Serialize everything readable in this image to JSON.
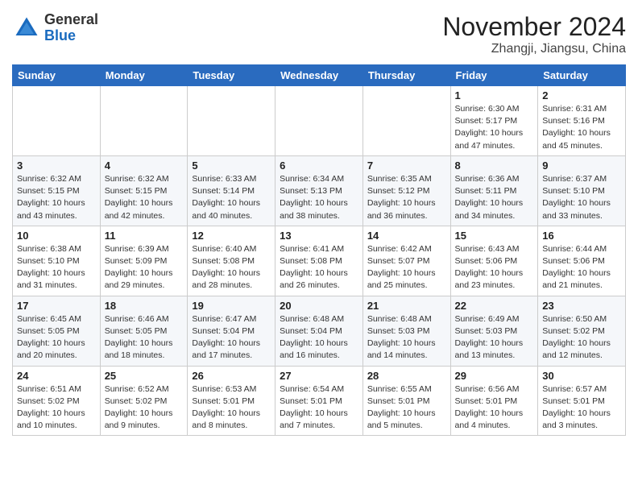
{
  "header": {
    "logo_general": "General",
    "logo_blue": "Blue",
    "month": "November 2024",
    "location": "Zhangji, Jiangsu, China"
  },
  "weekdays": [
    "Sunday",
    "Monday",
    "Tuesday",
    "Wednesday",
    "Thursday",
    "Friday",
    "Saturday"
  ],
  "weeks": [
    [
      {
        "day": "",
        "info": ""
      },
      {
        "day": "",
        "info": ""
      },
      {
        "day": "",
        "info": ""
      },
      {
        "day": "",
        "info": ""
      },
      {
        "day": "",
        "info": ""
      },
      {
        "day": "1",
        "info": "Sunrise: 6:30 AM\nSunset: 5:17 PM\nDaylight: 10 hours\nand 47 minutes."
      },
      {
        "day": "2",
        "info": "Sunrise: 6:31 AM\nSunset: 5:16 PM\nDaylight: 10 hours\nand 45 minutes."
      }
    ],
    [
      {
        "day": "3",
        "info": "Sunrise: 6:32 AM\nSunset: 5:15 PM\nDaylight: 10 hours\nand 43 minutes."
      },
      {
        "day": "4",
        "info": "Sunrise: 6:32 AM\nSunset: 5:15 PM\nDaylight: 10 hours\nand 42 minutes."
      },
      {
        "day": "5",
        "info": "Sunrise: 6:33 AM\nSunset: 5:14 PM\nDaylight: 10 hours\nand 40 minutes."
      },
      {
        "day": "6",
        "info": "Sunrise: 6:34 AM\nSunset: 5:13 PM\nDaylight: 10 hours\nand 38 minutes."
      },
      {
        "day": "7",
        "info": "Sunrise: 6:35 AM\nSunset: 5:12 PM\nDaylight: 10 hours\nand 36 minutes."
      },
      {
        "day": "8",
        "info": "Sunrise: 6:36 AM\nSunset: 5:11 PM\nDaylight: 10 hours\nand 34 minutes."
      },
      {
        "day": "9",
        "info": "Sunrise: 6:37 AM\nSunset: 5:10 PM\nDaylight: 10 hours\nand 33 minutes."
      }
    ],
    [
      {
        "day": "10",
        "info": "Sunrise: 6:38 AM\nSunset: 5:10 PM\nDaylight: 10 hours\nand 31 minutes."
      },
      {
        "day": "11",
        "info": "Sunrise: 6:39 AM\nSunset: 5:09 PM\nDaylight: 10 hours\nand 29 minutes."
      },
      {
        "day": "12",
        "info": "Sunrise: 6:40 AM\nSunset: 5:08 PM\nDaylight: 10 hours\nand 28 minutes."
      },
      {
        "day": "13",
        "info": "Sunrise: 6:41 AM\nSunset: 5:08 PM\nDaylight: 10 hours\nand 26 minutes."
      },
      {
        "day": "14",
        "info": "Sunrise: 6:42 AM\nSunset: 5:07 PM\nDaylight: 10 hours\nand 25 minutes."
      },
      {
        "day": "15",
        "info": "Sunrise: 6:43 AM\nSunset: 5:06 PM\nDaylight: 10 hours\nand 23 minutes."
      },
      {
        "day": "16",
        "info": "Sunrise: 6:44 AM\nSunset: 5:06 PM\nDaylight: 10 hours\nand 21 minutes."
      }
    ],
    [
      {
        "day": "17",
        "info": "Sunrise: 6:45 AM\nSunset: 5:05 PM\nDaylight: 10 hours\nand 20 minutes."
      },
      {
        "day": "18",
        "info": "Sunrise: 6:46 AM\nSunset: 5:05 PM\nDaylight: 10 hours\nand 18 minutes."
      },
      {
        "day": "19",
        "info": "Sunrise: 6:47 AM\nSunset: 5:04 PM\nDaylight: 10 hours\nand 17 minutes."
      },
      {
        "day": "20",
        "info": "Sunrise: 6:48 AM\nSunset: 5:04 PM\nDaylight: 10 hours\nand 16 minutes."
      },
      {
        "day": "21",
        "info": "Sunrise: 6:48 AM\nSunset: 5:03 PM\nDaylight: 10 hours\nand 14 minutes."
      },
      {
        "day": "22",
        "info": "Sunrise: 6:49 AM\nSunset: 5:03 PM\nDaylight: 10 hours\nand 13 minutes."
      },
      {
        "day": "23",
        "info": "Sunrise: 6:50 AM\nSunset: 5:02 PM\nDaylight: 10 hours\nand 12 minutes."
      }
    ],
    [
      {
        "day": "24",
        "info": "Sunrise: 6:51 AM\nSunset: 5:02 PM\nDaylight: 10 hours\nand 10 minutes."
      },
      {
        "day": "25",
        "info": "Sunrise: 6:52 AM\nSunset: 5:02 PM\nDaylight: 10 hours\nand 9 minutes."
      },
      {
        "day": "26",
        "info": "Sunrise: 6:53 AM\nSunset: 5:01 PM\nDaylight: 10 hours\nand 8 minutes."
      },
      {
        "day": "27",
        "info": "Sunrise: 6:54 AM\nSunset: 5:01 PM\nDaylight: 10 hours\nand 7 minutes."
      },
      {
        "day": "28",
        "info": "Sunrise: 6:55 AM\nSunset: 5:01 PM\nDaylight: 10 hours\nand 5 minutes."
      },
      {
        "day": "29",
        "info": "Sunrise: 6:56 AM\nSunset: 5:01 PM\nDaylight: 10 hours\nand 4 minutes."
      },
      {
        "day": "30",
        "info": "Sunrise: 6:57 AM\nSunset: 5:01 PM\nDaylight: 10 hours\nand 3 minutes."
      }
    ]
  ]
}
